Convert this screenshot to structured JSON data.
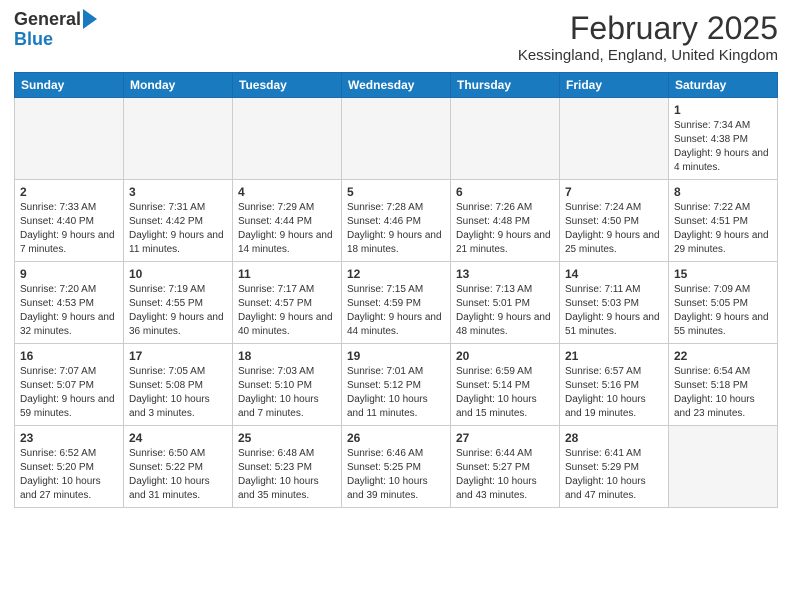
{
  "logo": {
    "general": "General",
    "blue": "Blue"
  },
  "header": {
    "month_title": "February 2025",
    "location": "Kessingland, England, United Kingdom"
  },
  "days_of_week": [
    "Sunday",
    "Monday",
    "Tuesday",
    "Wednesday",
    "Thursday",
    "Friday",
    "Saturday"
  ],
  "weeks": [
    [
      {
        "day": "",
        "info": ""
      },
      {
        "day": "",
        "info": ""
      },
      {
        "day": "",
        "info": ""
      },
      {
        "day": "",
        "info": ""
      },
      {
        "day": "",
        "info": ""
      },
      {
        "day": "",
        "info": ""
      },
      {
        "day": "1",
        "info": "Sunrise: 7:34 AM\nSunset: 4:38 PM\nDaylight: 9 hours and 4 minutes."
      }
    ],
    [
      {
        "day": "2",
        "info": "Sunrise: 7:33 AM\nSunset: 4:40 PM\nDaylight: 9 hours and 7 minutes."
      },
      {
        "day": "3",
        "info": "Sunrise: 7:31 AM\nSunset: 4:42 PM\nDaylight: 9 hours and 11 minutes."
      },
      {
        "day": "4",
        "info": "Sunrise: 7:29 AM\nSunset: 4:44 PM\nDaylight: 9 hours and 14 minutes."
      },
      {
        "day": "5",
        "info": "Sunrise: 7:28 AM\nSunset: 4:46 PM\nDaylight: 9 hours and 18 minutes."
      },
      {
        "day": "6",
        "info": "Sunrise: 7:26 AM\nSunset: 4:48 PM\nDaylight: 9 hours and 21 minutes."
      },
      {
        "day": "7",
        "info": "Sunrise: 7:24 AM\nSunset: 4:50 PM\nDaylight: 9 hours and 25 minutes."
      },
      {
        "day": "8",
        "info": "Sunrise: 7:22 AM\nSunset: 4:51 PM\nDaylight: 9 hours and 29 minutes."
      }
    ],
    [
      {
        "day": "9",
        "info": "Sunrise: 7:20 AM\nSunset: 4:53 PM\nDaylight: 9 hours and 32 minutes."
      },
      {
        "day": "10",
        "info": "Sunrise: 7:19 AM\nSunset: 4:55 PM\nDaylight: 9 hours and 36 minutes."
      },
      {
        "day": "11",
        "info": "Sunrise: 7:17 AM\nSunset: 4:57 PM\nDaylight: 9 hours and 40 minutes."
      },
      {
        "day": "12",
        "info": "Sunrise: 7:15 AM\nSunset: 4:59 PM\nDaylight: 9 hours and 44 minutes."
      },
      {
        "day": "13",
        "info": "Sunrise: 7:13 AM\nSunset: 5:01 PM\nDaylight: 9 hours and 48 minutes."
      },
      {
        "day": "14",
        "info": "Sunrise: 7:11 AM\nSunset: 5:03 PM\nDaylight: 9 hours and 51 minutes."
      },
      {
        "day": "15",
        "info": "Sunrise: 7:09 AM\nSunset: 5:05 PM\nDaylight: 9 hours and 55 minutes."
      }
    ],
    [
      {
        "day": "16",
        "info": "Sunrise: 7:07 AM\nSunset: 5:07 PM\nDaylight: 9 hours and 59 minutes."
      },
      {
        "day": "17",
        "info": "Sunrise: 7:05 AM\nSunset: 5:08 PM\nDaylight: 10 hours and 3 minutes."
      },
      {
        "day": "18",
        "info": "Sunrise: 7:03 AM\nSunset: 5:10 PM\nDaylight: 10 hours and 7 minutes."
      },
      {
        "day": "19",
        "info": "Sunrise: 7:01 AM\nSunset: 5:12 PM\nDaylight: 10 hours and 11 minutes."
      },
      {
        "day": "20",
        "info": "Sunrise: 6:59 AM\nSunset: 5:14 PM\nDaylight: 10 hours and 15 minutes."
      },
      {
        "day": "21",
        "info": "Sunrise: 6:57 AM\nSunset: 5:16 PM\nDaylight: 10 hours and 19 minutes."
      },
      {
        "day": "22",
        "info": "Sunrise: 6:54 AM\nSunset: 5:18 PM\nDaylight: 10 hours and 23 minutes."
      }
    ],
    [
      {
        "day": "23",
        "info": "Sunrise: 6:52 AM\nSunset: 5:20 PM\nDaylight: 10 hours and 27 minutes."
      },
      {
        "day": "24",
        "info": "Sunrise: 6:50 AM\nSunset: 5:22 PM\nDaylight: 10 hours and 31 minutes."
      },
      {
        "day": "25",
        "info": "Sunrise: 6:48 AM\nSunset: 5:23 PM\nDaylight: 10 hours and 35 minutes."
      },
      {
        "day": "26",
        "info": "Sunrise: 6:46 AM\nSunset: 5:25 PM\nDaylight: 10 hours and 39 minutes."
      },
      {
        "day": "27",
        "info": "Sunrise: 6:44 AM\nSunset: 5:27 PM\nDaylight: 10 hours and 43 minutes."
      },
      {
        "day": "28",
        "info": "Sunrise: 6:41 AM\nSunset: 5:29 PM\nDaylight: 10 hours and 47 minutes."
      },
      {
        "day": "",
        "info": ""
      }
    ]
  ]
}
